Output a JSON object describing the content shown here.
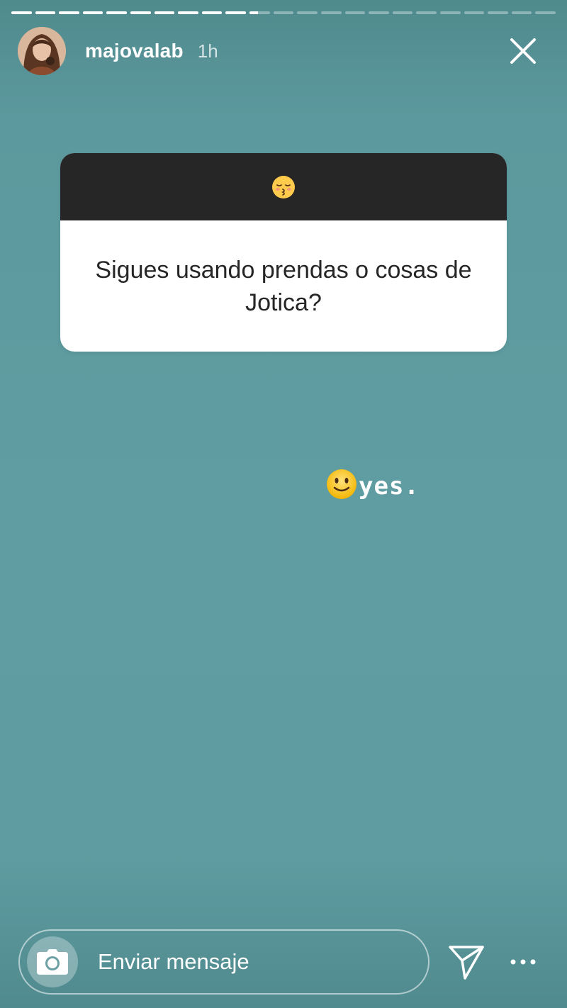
{
  "progress": {
    "segments": [
      1,
      1,
      1,
      1,
      1,
      1,
      1,
      1,
      1,
      1,
      0.4,
      0,
      0,
      0,
      0,
      0,
      0,
      0,
      0,
      0,
      0,
      0,
      0
    ]
  },
  "header": {
    "username": "majovalab",
    "time": "1h"
  },
  "card": {
    "emoji": "kissing-face-closed-eyes-icon",
    "question": "Sigues usando prendas o cosas de Jotica?"
  },
  "reply": {
    "emoji": "slightly-smiling-face-icon",
    "text": "yes."
  },
  "bottom": {
    "message_placeholder": "Enviar mensaje"
  },
  "colors": {
    "background": "#5f9da2",
    "card_header": "#262626",
    "card_body": "#ffffff",
    "text": "#262626"
  }
}
